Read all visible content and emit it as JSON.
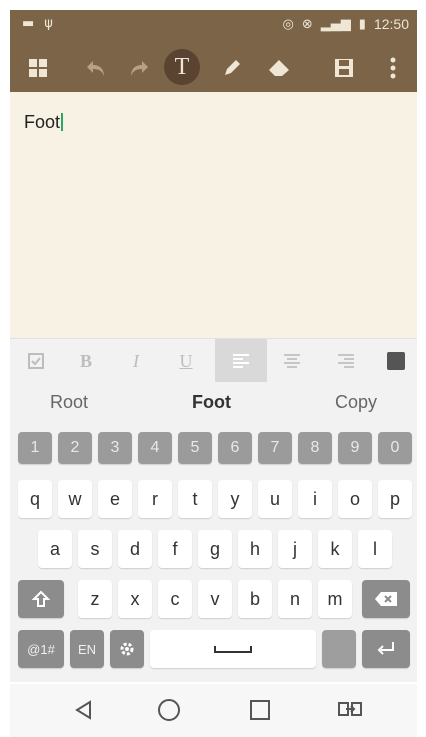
{
  "status": {
    "time": "12:50"
  },
  "toolbar": {
    "icons": [
      "grid-icon",
      "undo-icon",
      "redo-icon",
      "text-icon",
      "pen-icon",
      "eraser-icon",
      "save-icon",
      "more-icon"
    ],
    "text_glyph": "T"
  },
  "editor": {
    "text": "Foot"
  },
  "format": {
    "bold": "B",
    "italic": "I",
    "underline": "U"
  },
  "suggestions": {
    "left": "Root",
    "center": "Foot",
    "right": "Copy"
  },
  "keyboard": {
    "numbers": [
      "1",
      "2",
      "3",
      "4",
      "5",
      "6",
      "7",
      "8",
      "9",
      "0"
    ],
    "row1": [
      "q",
      "w",
      "e",
      "r",
      "t",
      "y",
      "u",
      "i",
      "o",
      "p"
    ],
    "row2": [
      "a",
      "s",
      "d",
      "f",
      "g",
      "h",
      "j",
      "k",
      "l"
    ],
    "row3": [
      "z",
      "x",
      "c",
      "v",
      "b",
      "n",
      "m"
    ],
    "symbols_label": "@1#",
    "lang_label": "EN"
  },
  "colors": {
    "toolbar": "#7b6447",
    "editor_bg": "#f8f2e4",
    "caret": "#27a86a"
  }
}
